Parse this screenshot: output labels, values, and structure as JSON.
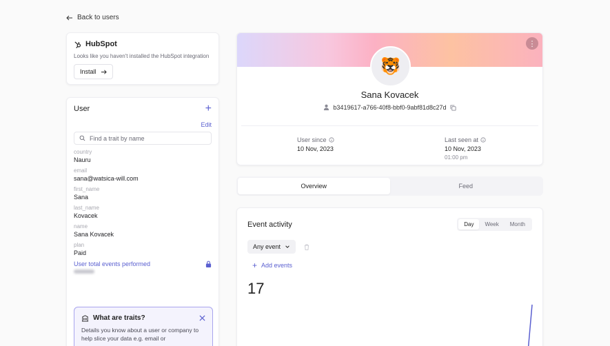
{
  "nav": {
    "back_label": "Back to users"
  },
  "hubspot": {
    "title": "HubSpot",
    "description": "Looks like you haven't installed the HubSpot integration",
    "install_label": "Install"
  },
  "user_panel": {
    "title": "User",
    "edit_label": "Edit",
    "search_placeholder": "Find a trait by name",
    "traits": [
      {
        "key": "country",
        "value": "Nauru"
      },
      {
        "key": "email",
        "value": "sana@watsica-will.com"
      },
      {
        "key": "first_name",
        "value": "Sana"
      },
      {
        "key": "last_name",
        "value": "Kovacek"
      },
      {
        "key": "name",
        "value": "Sana Kovacek"
      },
      {
        "key": "plan",
        "value": "Paid"
      }
    ],
    "locked_trait": "User total events performed",
    "info": {
      "title": "What are traits?",
      "body": "Details you know about a user or company to help slice your data e.g. email or"
    }
  },
  "profile": {
    "avatar_emoji": "🐯",
    "name": "Sana Kovacek",
    "user_id": "b3419617-a766-40f8-bbf0-9abf81d8c27d",
    "user_since_label": "User since",
    "user_since_value": "10 Nov, 2023",
    "last_seen_label": "Last seen at",
    "last_seen_value": "10 Nov, 2023",
    "last_seen_time": "01:00 pm"
  },
  "tabs": [
    {
      "label": "Overview",
      "active": true
    },
    {
      "label": "Feed",
      "active": false
    }
  ],
  "events": {
    "title": "Event activity",
    "ranges": [
      "Day",
      "Week",
      "Month"
    ],
    "selected_range": "Day",
    "event_filter": "Any event",
    "add_events_label": "Add events",
    "total": "17"
  },
  "colors": {
    "accent": "#5a5fd0"
  }
}
